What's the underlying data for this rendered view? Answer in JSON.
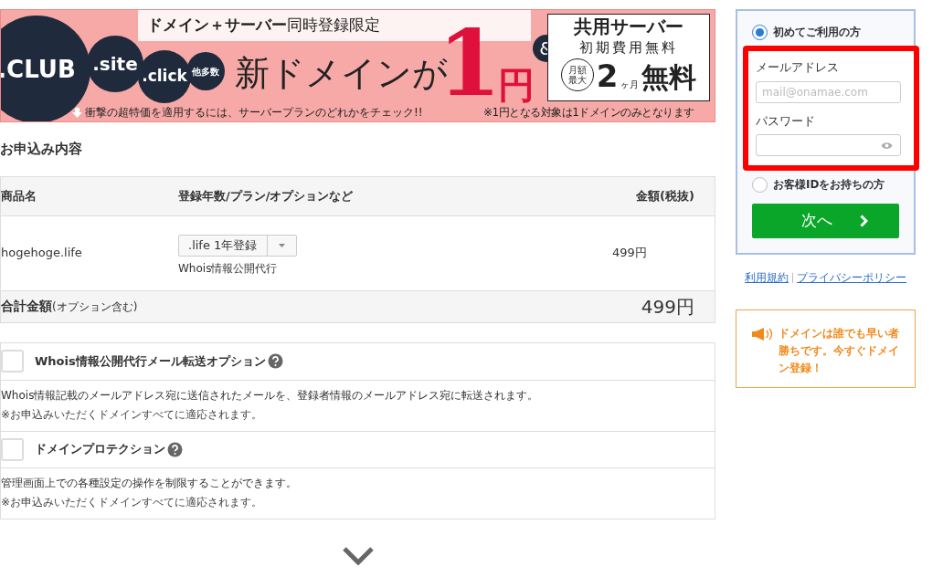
{
  "banner": {
    "domains": [
      {
        "label": ".CLUB",
        "kind": "large"
      },
      {
        "label": ".site",
        "kind": "medium"
      },
      {
        "label": ".click",
        "kind": "medium"
      },
      {
        "label": "他多数",
        "kind": "small"
      }
    ],
    "headline": "**ドメイン＋サーバー**同時登録限定",
    "main": "新ドメインが",
    "price_number": "1",
    "price_unit": "円",
    "note": "衝撃の超特価を適用するには、サーバープランのどれかをチェック!!",
    "ampersand": "&",
    "server": {
      "title": "共用サーバー",
      "subtitle": "初期費用無料",
      "badge_top": "月額",
      "badge_bottom": "最大",
      "months": "2",
      "months_unit": "ヶ月",
      "free": "無料"
    },
    "footnote": "※1円となる対象は1ドメインのみとなります"
  },
  "order": {
    "title": "お申込み内容",
    "columns": [
      "商品名",
      "登録年数/プラン/オプションなど",
      "金額(税抜)"
    ],
    "rows": [
      {
        "product": "hogehoge.life",
        "plan": ".life 1年登録",
        "option": "Whois情報公開代行",
        "price": "499円"
      }
    ],
    "total": {
      "label": "合計金額",
      "sub": "(オプション含む)",
      "amount": "499円"
    }
  },
  "options": [
    {
      "title": "Whois情報公開代行メール転送オプション",
      "checked": false,
      "description": "Whois情報記載のメールアドレス宛に送信されたメールを、登録者情報のメールアドレス宛に転送されます。",
      "note": "※お申込みいただくドメインすべてに適応されます。"
    },
    {
      "title": "ドメインプロテクション",
      "checked": false,
      "description": "管理画面上での各種設定の操作を制限することができます。",
      "note": "※お申込みいただくドメインすべてに適応されます。"
    }
  ],
  "login": {
    "choices": [
      {
        "label": "初めてご利用の方",
        "selected": true
      },
      {
        "label": "お客様IDをお持ちの方",
        "selected": false
      }
    ],
    "email_label": "メールアドレス",
    "email_placeholder": "mail@onamae.com",
    "password_label": "パスワード",
    "button": "次へ",
    "links": [
      "利用規約",
      "プライバシーポリシー"
    ]
  },
  "notice": "ドメインは誰でも早い者勝ちです。今すぐドメイン登録！"
}
